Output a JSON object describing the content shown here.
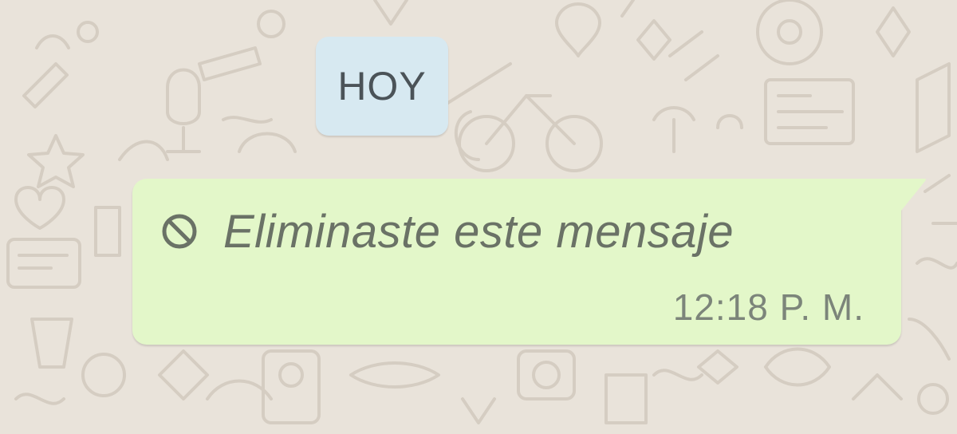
{
  "colors": {
    "chat_background": "#e9e3da",
    "doodle_stroke": "#d5cdc2",
    "date_chip_background": "#d7e9f1",
    "date_chip_text": "#4b5358",
    "bubble_background": "#e3f7c9",
    "deleted_text": "#6a7266",
    "deleted_icon": "#6a7266",
    "timestamp_text": "#7c857a"
  },
  "conversation": {
    "date_separator": {
      "label": "HOY"
    },
    "messages": [
      {
        "direction": "outgoing",
        "deleted": true,
        "icon": "blocked-icon",
        "text": "Eliminaste este mensaje",
        "time": "12:18 P. M."
      }
    ]
  }
}
